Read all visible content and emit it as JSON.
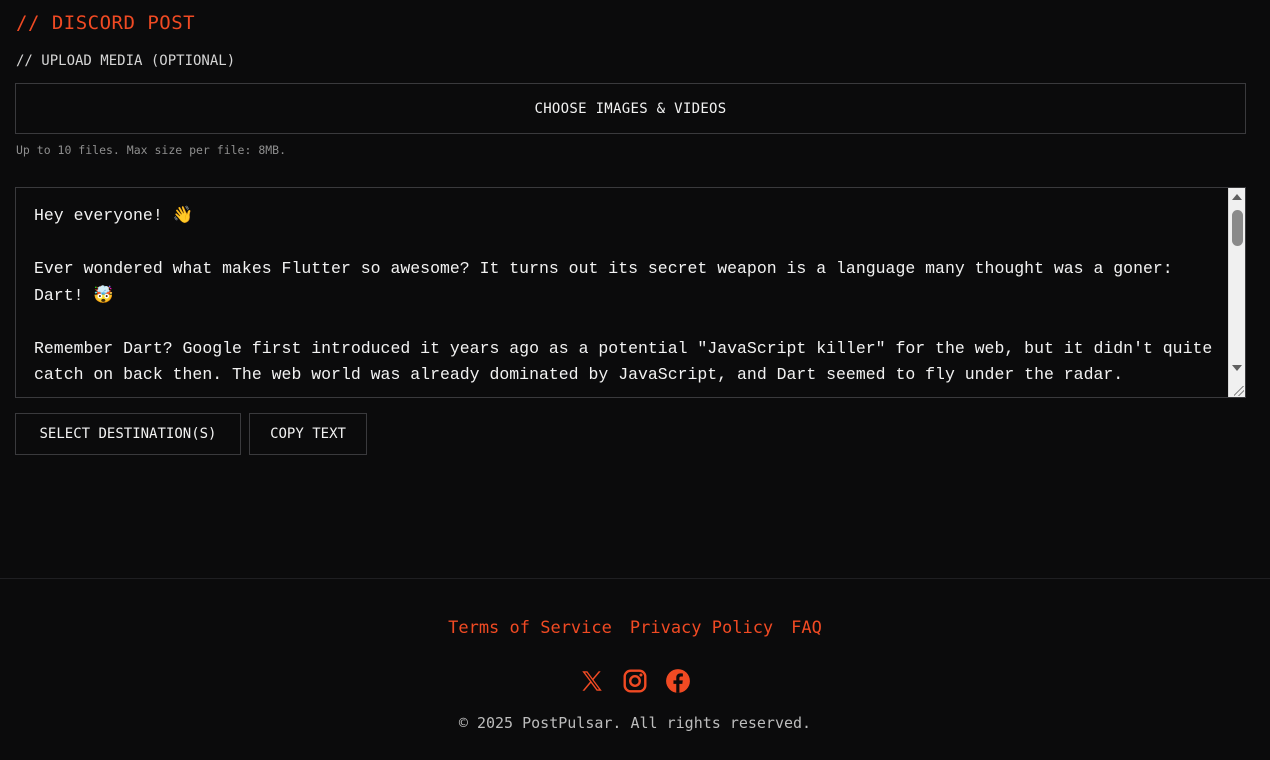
{
  "header": {
    "title": "// DISCORD POST"
  },
  "upload": {
    "label": "// UPLOAD MEDIA (OPTIONAL)",
    "button_label": "CHOOSE IMAGES & VIDEOS",
    "hint": "Up to 10 files. Max size per file: 8MB."
  },
  "post": {
    "text": "Hey everyone! 👋\n\nEver wondered what makes Flutter so awesome? It turns out its secret weapon is a language many thought was a goner: Dart! 🤯\n\nRemember Dart? Google first introduced it years ago as a potential \"JavaScript killer\" for the web, but it didn't quite catch on back then. The web world was already dominated by JavaScript, and Dart seemed to fly under the radar."
  },
  "actions": {
    "select_destination_label": "SELECT DESTINATION(S)",
    "copy_text_label": "COPY TEXT"
  },
  "footer": {
    "links": {
      "terms": "Terms of Service",
      "privacy": "Privacy Policy",
      "faq": "FAQ"
    },
    "social_icons": [
      "x-icon",
      "instagram-icon",
      "facebook-icon"
    ],
    "copyright": "© 2025 PostPulsar. All rights reserved."
  },
  "colors": {
    "accent": "#f04a23",
    "background": "#0b0b0c",
    "border": "#3a3a3d"
  }
}
